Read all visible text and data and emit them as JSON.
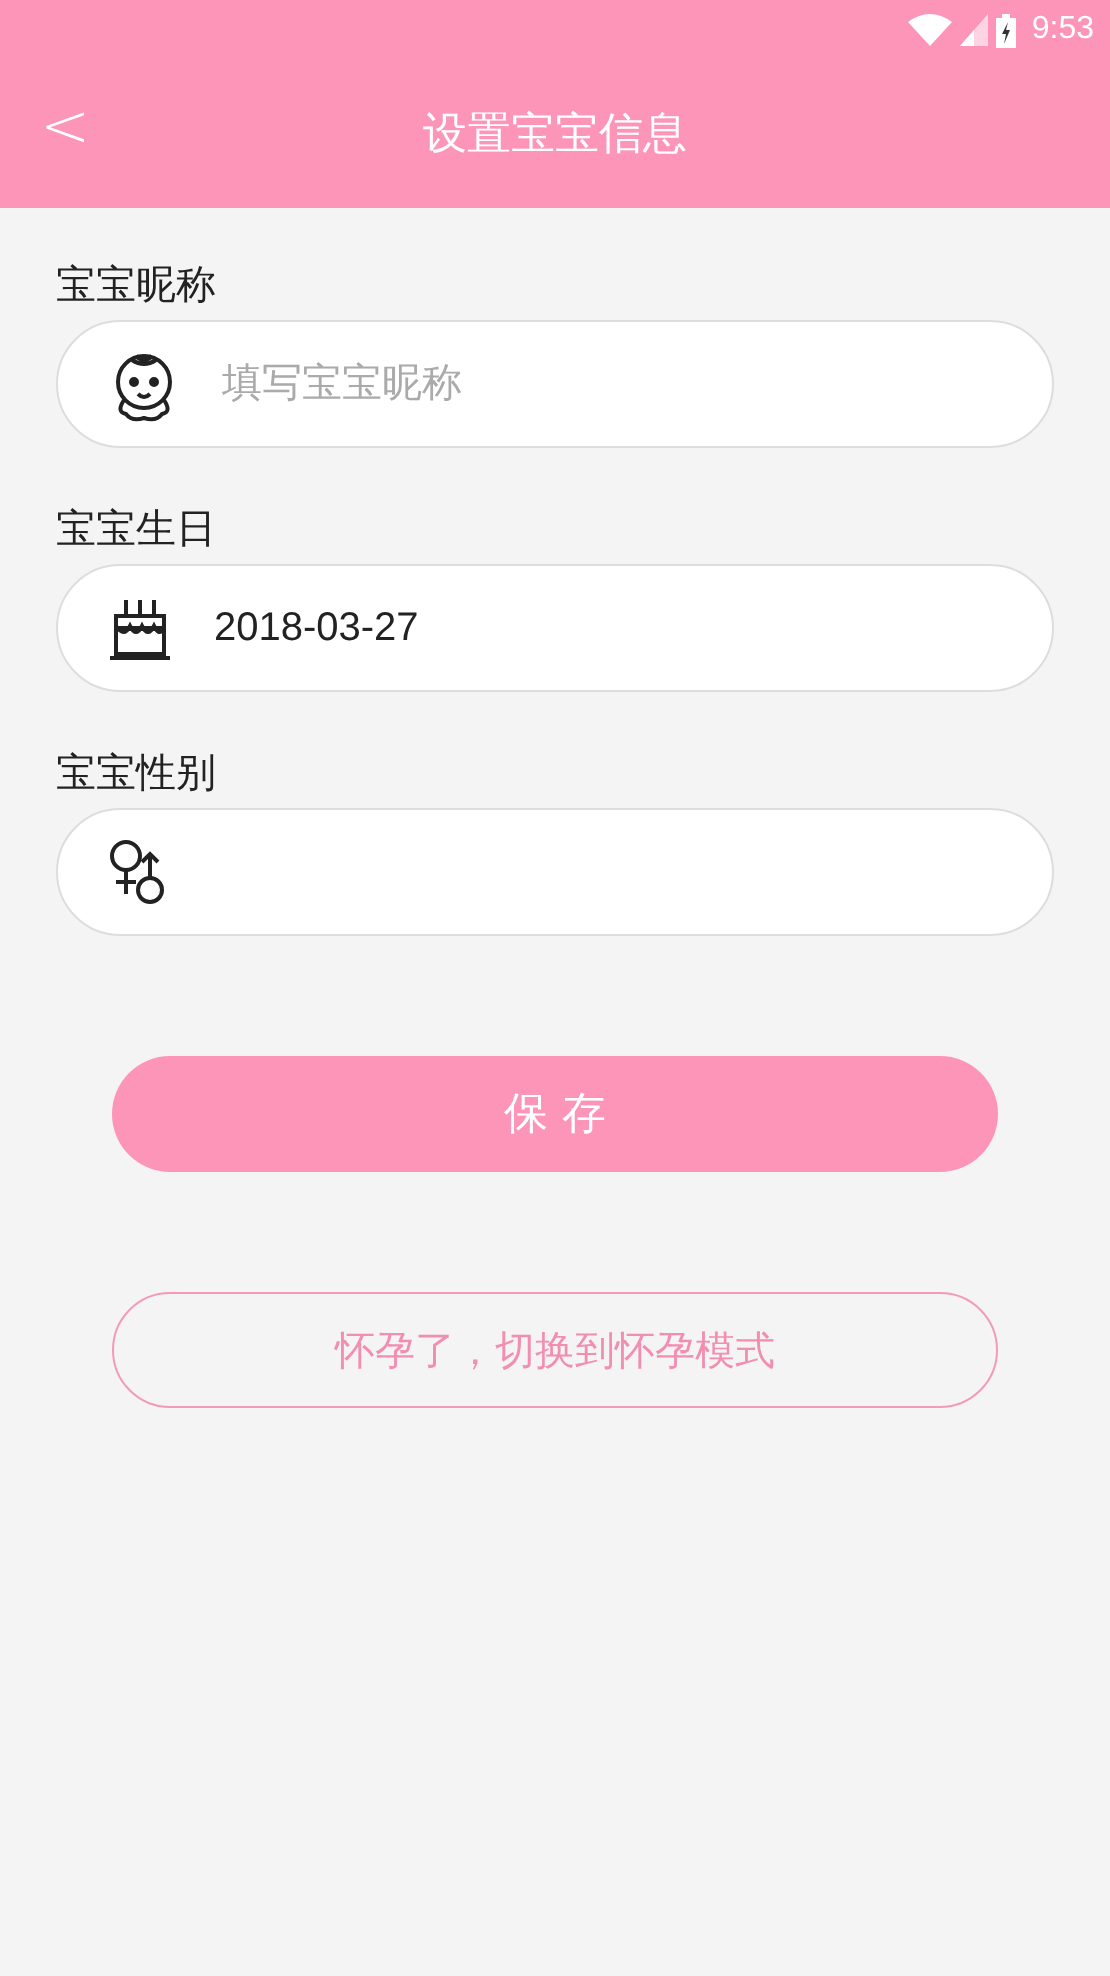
{
  "status_bar": {
    "time": "9:53"
  },
  "header": {
    "back": "<",
    "title": "设置宝宝信息"
  },
  "fields": [
    {
      "label": "宝宝昵称",
      "kind": "nickname",
      "placeholder": "填写宝宝昵称"
    },
    {
      "label": "宝宝生日",
      "kind": "birthday",
      "value": "2018-03-27"
    },
    {
      "label": "宝宝性别",
      "kind": "gender"
    }
  ],
  "save_button": "保 存",
  "switch_button": "怀孕了，切换到怀孕模式"
}
